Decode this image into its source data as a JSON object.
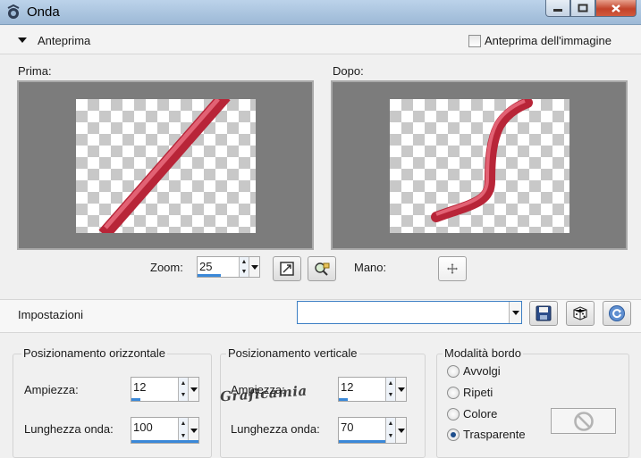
{
  "window": {
    "title": "Onda"
  },
  "preview": {
    "header": "Anteprima",
    "image_preview_label": "Anteprima dell'immagine",
    "before_label": "Prima:",
    "after_label": "Dopo:",
    "zoom_label": "Zoom:",
    "zoom_value": "25",
    "pan_label": "Mano:"
  },
  "settings": {
    "label": "Impostazioni",
    "preset_value": ""
  },
  "horizontal": {
    "title": "Posizionamento orizzontale",
    "amplitude_label": "Ampiezza:",
    "amplitude_value": "12",
    "wavelength_label": "Lunghezza onda:",
    "wavelength_value": "100"
  },
  "vertical": {
    "title": "Posizionamento verticale",
    "amplitude_label": "Ampiezza:",
    "amplitude_value": "12",
    "wavelength_label": "Lunghezza onda:",
    "wavelength_value": "70"
  },
  "edge_mode": {
    "title": "Modalità bordo",
    "options": [
      "Avvolgi",
      "Ripeti",
      "Colore",
      "Trasparente"
    ],
    "selected": "Trasparente"
  },
  "watermark": "Graficamia",
  "colors": {
    "accent": "#3a88d8",
    "stroke": "#c9344a",
    "panel_bg": "#7c7c7c"
  },
  "icons": [
    "app-icon",
    "minimize-icon",
    "maximize-icon",
    "close-icon",
    "collapse-arrow-icon",
    "zoom-fit-icon",
    "zoom-preview-icon",
    "pan-icon",
    "save-preset-icon",
    "randomize-icon",
    "reset-icon",
    "disabled-color-icon"
  ]
}
